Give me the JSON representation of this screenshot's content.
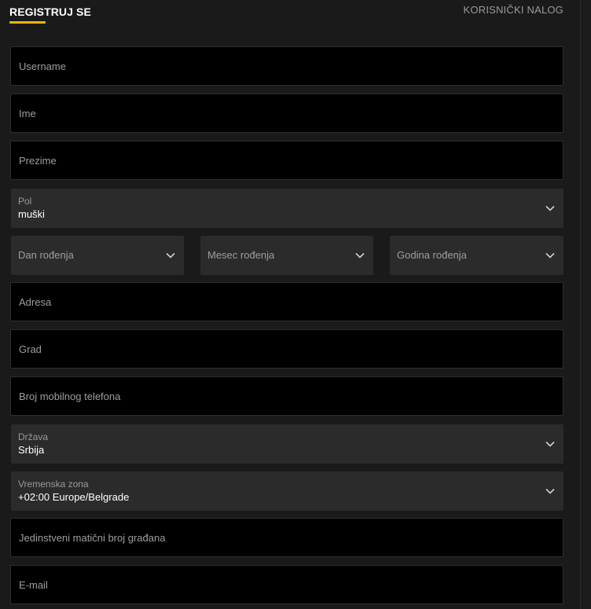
{
  "header": {
    "register_tab": "REGISTRUJ SE",
    "account_tab": "KORISNIČKI NALOG"
  },
  "form": {
    "username": {
      "placeholder": "Username"
    },
    "first_name": {
      "placeholder": "Ime"
    },
    "last_name": {
      "placeholder": "Prezime"
    },
    "gender": {
      "label": "Pol",
      "value": "muški"
    },
    "birth_day": {
      "placeholder": "Dan rođenja"
    },
    "birth_month": {
      "placeholder": "Mesec rođenja"
    },
    "birth_year": {
      "placeholder": "Godina rođenja"
    },
    "address": {
      "placeholder": "Adresa"
    },
    "city": {
      "placeholder": "Grad"
    },
    "mobile": {
      "placeholder": "Broj mobilnog telefona"
    },
    "country": {
      "label": "Država",
      "value": "Srbija"
    },
    "timezone": {
      "label": "Vremenska zona",
      "value": "+02:00 Europe/Belgrade"
    },
    "jmbg": {
      "placeholder": "Jedinstveni matični broj građana"
    },
    "email": {
      "placeholder": "E-mail"
    }
  },
  "colors": {
    "accent": "#f0b400",
    "background": "#1a1a1a",
    "input_bg": "#000000",
    "select_bg": "#2b2b2b"
  },
  "icons": [
    "chevron-down-icon"
  ]
}
